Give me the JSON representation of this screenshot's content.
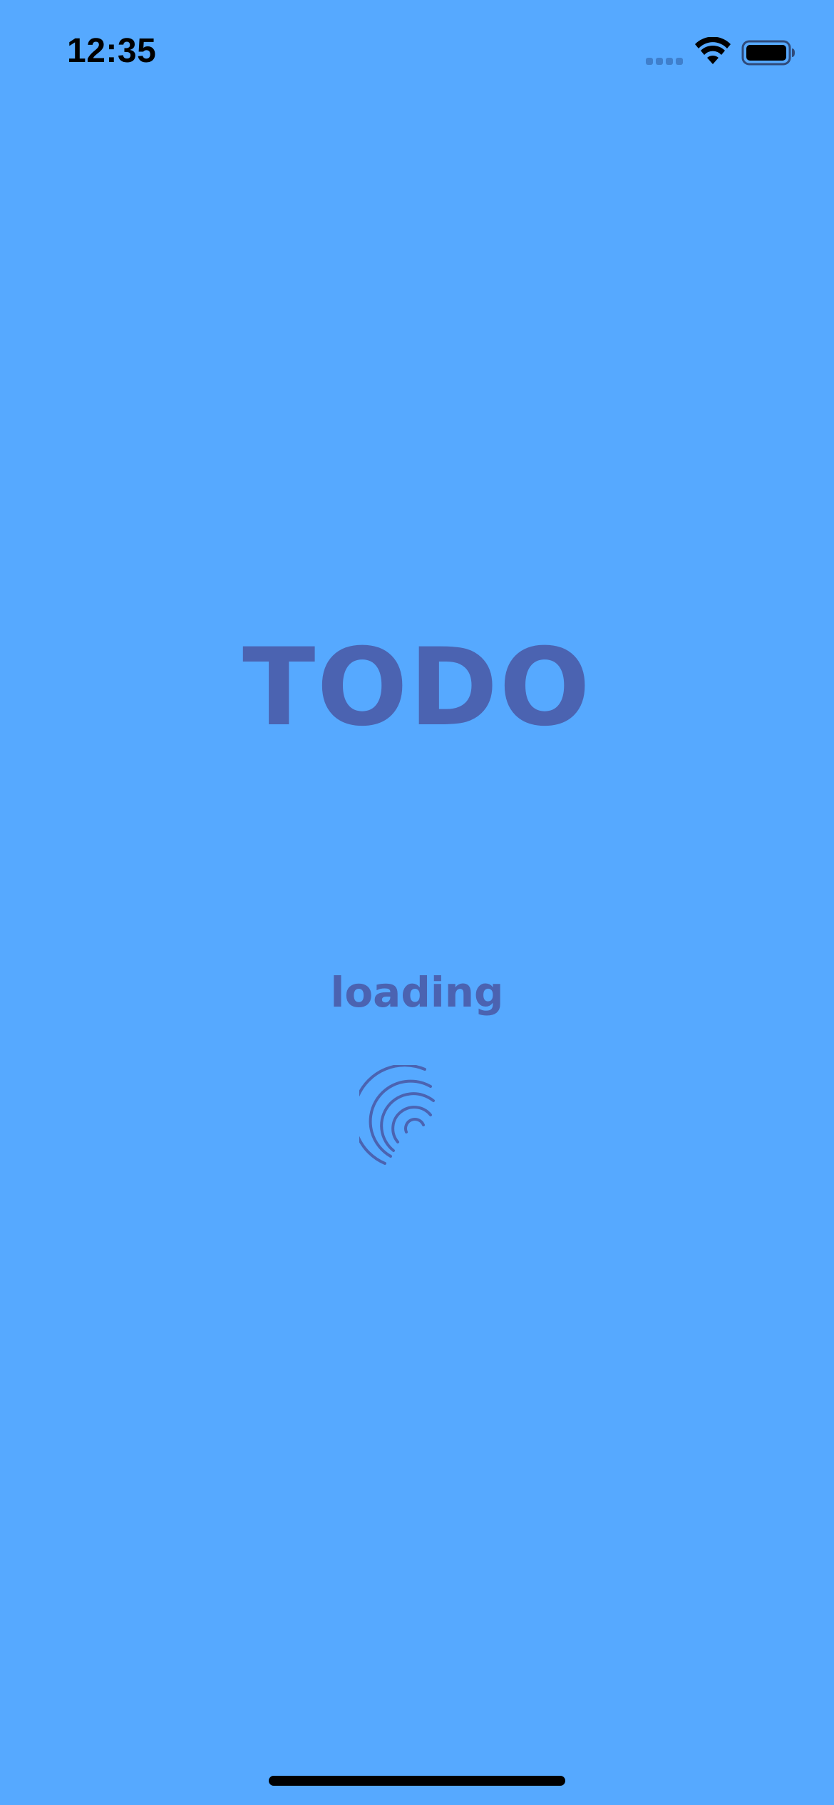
{
  "status_bar": {
    "time": "12:35"
  },
  "icons": {
    "signal": "cellular-signal-icon",
    "wifi": "wifi-icon",
    "battery": "battery-icon",
    "spinner": "loading-spinner-icon"
  },
  "splash": {
    "title": "TODO",
    "loading_text": "loading"
  },
  "colors": {
    "background": "#56a9ff",
    "accent": "#4b63b1",
    "status_foreground": "#000000"
  }
}
